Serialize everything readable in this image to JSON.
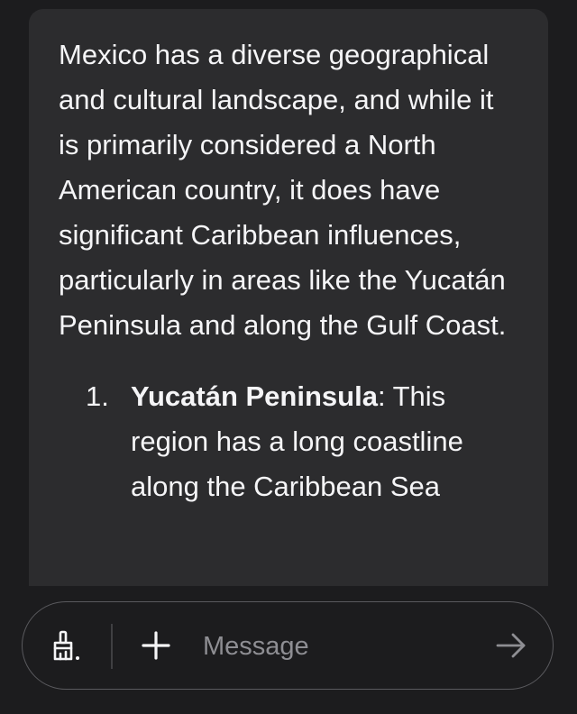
{
  "message": {
    "intro": "Mexico has a diverse geographical and cultural landscape, and while it is primarily considered a North American country, it does have significant Caribbean influences, particularly in areas like the Yucatán Peninsula and along the Gulf Coast.",
    "list": [
      {
        "number": "1.",
        "title": "Yucatán Peninsula",
        "text": ": This region has a long coastline along the Caribbean Sea"
      }
    ]
  },
  "composer": {
    "placeholder": "Message",
    "icons": {
      "tools": "paintbrush-icon",
      "add": "plus-icon",
      "send": "arrow-right-icon"
    }
  },
  "colors": {
    "background": "#1c1c1e",
    "bubble": "#2c2c2e",
    "text": "#f5f5f7",
    "placeholder": "#8e8e93",
    "border": "#5a5a5e"
  }
}
